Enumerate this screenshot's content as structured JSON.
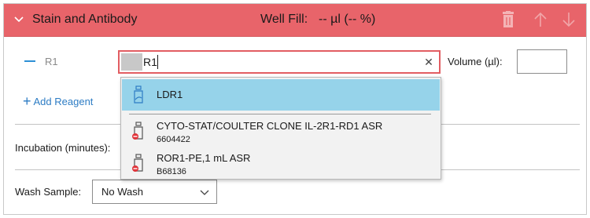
{
  "header": {
    "title": "Stain and Antibody",
    "well_fill_label": "Well Fill:",
    "well_fill_value": "-- µl  (-- %)",
    "color": "#e8646a"
  },
  "reagent_row": {
    "label": "R1",
    "search_value": "R1",
    "volume_label": "Volume (µl):",
    "volume_value": ""
  },
  "add_reagent_label": "Add Reagent",
  "incubation_label": "Incubation (minutes):",
  "wash": {
    "label": "Wash Sample:",
    "selected": "No Wash"
  },
  "dropdown": {
    "items": [
      {
        "name": "LDR1",
        "code": "",
        "icon": "reagent-bottle-icon",
        "selected": true
      },
      {
        "name": "CYTO-STAT/COULTER CLONE IL-2R1-RD1 ASR",
        "code": "6604422",
        "icon": "reagent-bottle-restricted-icon",
        "selected": false
      },
      {
        "name": "ROR1-PE,1 mL ASR",
        "code": "B68136",
        "icon": "reagent-bottle-restricted-icon",
        "selected": false
      }
    ]
  }
}
